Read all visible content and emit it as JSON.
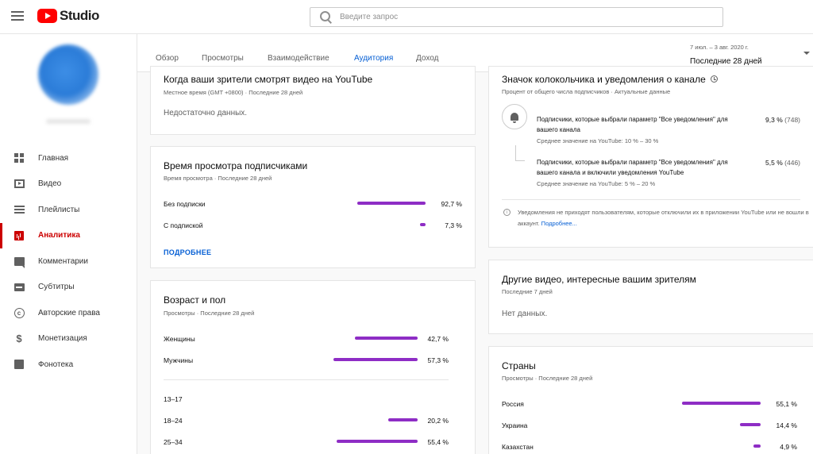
{
  "app": {
    "logo_text": "Studio"
  },
  "search": {
    "placeholder": "Введите запрос"
  },
  "sidebar": {
    "items": [
      {
        "label": "Главная",
        "icon": "dashboard-icon",
        "active": false
      },
      {
        "label": "Видео",
        "icon": "video-icon",
        "active": false
      },
      {
        "label": "Плейлисты",
        "icon": "playlist-icon",
        "active": false
      },
      {
        "label": "Аналитика",
        "icon": "analytics-icon",
        "active": true
      },
      {
        "label": "Комментарии",
        "icon": "comments-icon",
        "active": false
      },
      {
        "label": "Субтитры",
        "icon": "subtitles-icon",
        "active": false
      },
      {
        "label": "Авторские права",
        "icon": "copyright-icon",
        "active": false
      },
      {
        "label": "Монетизация",
        "icon": "dollar-icon",
        "active": false
      },
      {
        "label": "Фонотека",
        "icon": "audio-library-icon",
        "active": false
      }
    ]
  },
  "tabs": [
    {
      "label": "Обзор",
      "active": false
    },
    {
      "label": "Просмотры",
      "active": false
    },
    {
      "label": "Взаимодействие",
      "active": false
    },
    {
      "label": "Аудитория",
      "active": true
    },
    {
      "label": "Доход",
      "active": false
    }
  ],
  "date": {
    "range": "7 июл. – 3 авг. 2020 г.",
    "label": "Последние 28 дней"
  },
  "cards": {
    "when": {
      "title": "Когда ваши зрители смотрят видео на YouTube",
      "subtitle": "Местное время (GMT +0800) · Последние 28 дней",
      "empty": "Недостаточно данных."
    },
    "subs_watch": {
      "title": "Время просмотра подписчиками",
      "subtitle": "Время просмотра · Последние 28 дней",
      "rows": [
        {
          "label": "Без подписки",
          "value": "92,7 %",
          "pct": 92.7
        },
        {
          "label": "С подпиской",
          "value": "7,3 %",
          "pct": 7.3
        }
      ],
      "more": "ПОДРОБНЕЕ"
    },
    "age_gender": {
      "title": "Возраст и пол",
      "subtitle": "Просмотры · Последние 28 дней",
      "gender": [
        {
          "label": "Женщины",
          "value": "42,7 %",
          "pct": 42.7
        },
        {
          "label": "Мужчины",
          "value": "57,3 %",
          "pct": 57.3
        }
      ],
      "ages": [
        {
          "label": "13–17",
          "value": "",
          "pct": 0
        },
        {
          "label": "18–24",
          "value": "20,2 %",
          "pct": 20.2
        },
        {
          "label": "25–34",
          "value": "55,4 %",
          "pct": 55.4
        }
      ]
    },
    "bell": {
      "title": "Значок колокольчика и уведомления о канале",
      "subtitle": "Процент от общего числа подписчиков · Актуальные данные",
      "rows": [
        {
          "text": "Подписчики, которые выбрали параметр \"Все уведомления\" для вашего канала",
          "avg": "Среднее значение на YouTube: 10 % – 30 %",
          "value": "9,3 %",
          "count": "(748)"
        },
        {
          "text": "Подписчики, которые выбрали параметр \"Все уведомления\" для вашего канала и включили уведомления YouTube",
          "avg": "Среднее значение на YouTube: 5 % – 20 %",
          "value": "5,5 %",
          "count": "(446)"
        }
      ],
      "info": "Уведомления не приходят пользователям, которые отключили их в приложении YouTube или не вошли в аккаунт.",
      "info_link": "Подробнее..."
    },
    "other_videos": {
      "title": "Другие видео, интересные вашим зрителям",
      "subtitle": "Последние 7 дней",
      "empty": "Нет данных."
    },
    "countries": {
      "title": "Страны",
      "subtitle": "Просмотры · Последние 28 дней",
      "rows": [
        {
          "label": "Россия",
          "value": "55,1 %",
          "pct": 55.1
        },
        {
          "label": "Украина",
          "value": "14,4 %",
          "pct": 14.4
        },
        {
          "label": "Казахстан",
          "value": "4,9 %",
          "pct": 4.9
        }
      ]
    }
  },
  "colors": {
    "accent": "#065fd4",
    "bar": "#8e2dc5",
    "active_nav": "#cc0000",
    "logo_red": "#ff0000"
  }
}
